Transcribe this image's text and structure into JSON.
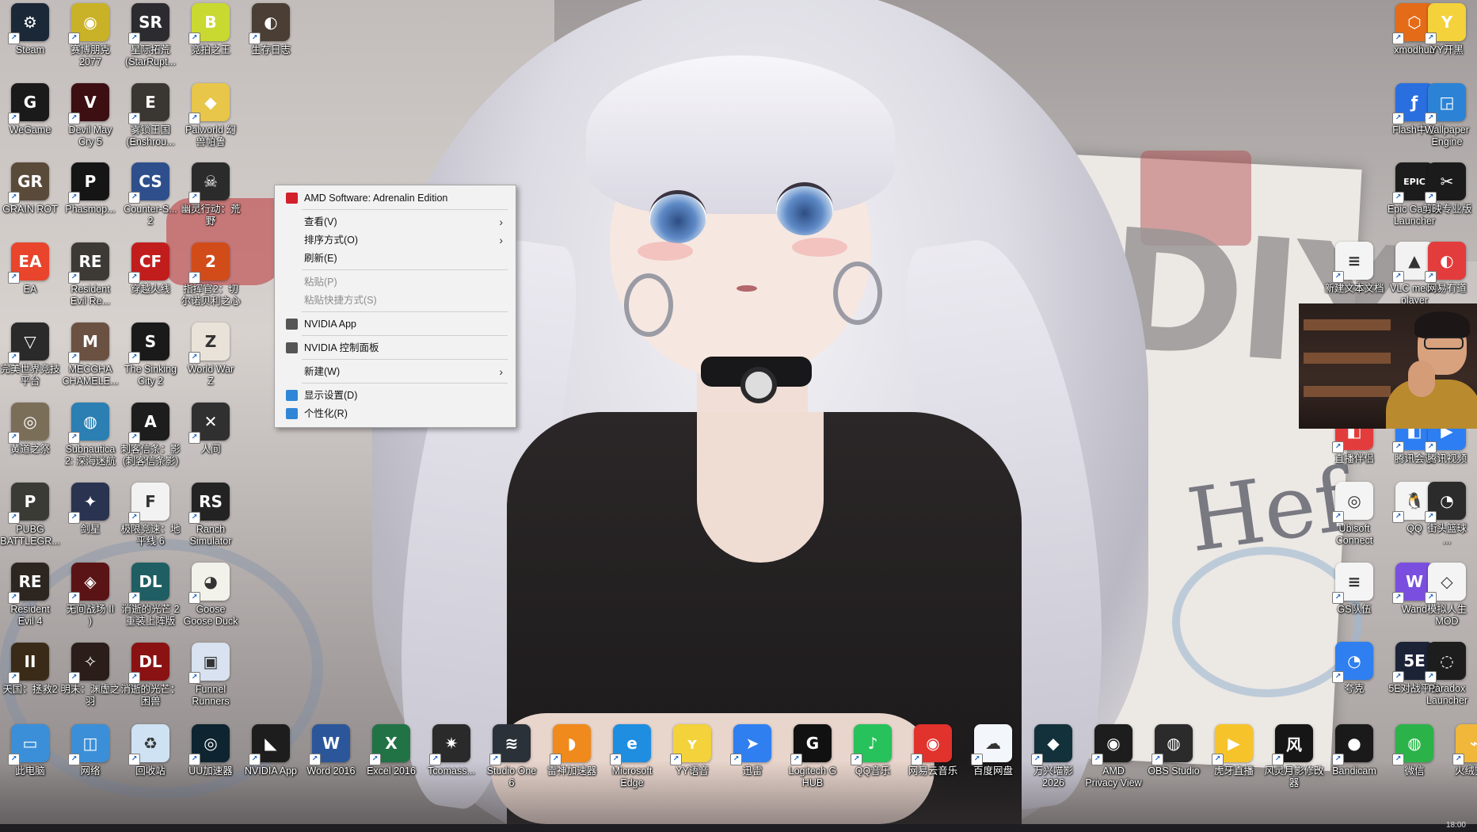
{
  "desktop_icons": [
    {
      "label": "Steam",
      "text": "",
      "bg": "#1b2838",
      "glyph": "⚙"
    },
    {
      "label": "赛博朋克\n2077",
      "text": "",
      "bg": "#c9b227",
      "glyph": "◉"
    },
    {
      "label": "星际拓荒\n(StarRupt...",
      "text": "",
      "bg": "#2c2b30",
      "glyph": "SR"
    },
    {
      "label": "竞拍之王",
      "text": "",
      "bg": "#c9d931",
      "glyph": "B"
    },
    {
      "label": "生存日志",
      "text": "",
      "bg": "#4a3e35",
      "glyph": "◐"
    },
    {
      "label": "WeGame",
      "text": "",
      "bg": "#1a1a1a",
      "glyph": "G"
    },
    {
      "label": "Devil May\nCry 5",
      "text": "",
      "bg": "#3d0f12",
      "glyph": "V"
    },
    {
      "label": "雾锁王国\n(Enshrou...",
      "text": "",
      "bg": "#3a3631",
      "glyph": "E"
    },
    {
      "label": "Palworld 幻\n兽帕鲁",
      "text": "",
      "bg": "#e7c64a",
      "glyph": "◆"
    },
    {
      "label": "GRAIN ROT",
      "text": "",
      "bg": "#5a4a3a",
      "glyph": "GR"
    },
    {
      "label": "Phasmop...",
      "text": "",
      "bg": "#151515",
      "glyph": "P"
    },
    {
      "label": "Counter-S...\n2",
      "text": "",
      "bg": "#2e4f8c",
      "glyph": "CS"
    },
    {
      "label": "幽灵行动：荒\n野",
      "text": "",
      "bg": "#2b2b2b",
      "glyph": "☠"
    },
    {
      "label": "EA",
      "text": "",
      "bg": "#e8452c",
      "glyph": "EA"
    },
    {
      "label": "Resident\nEvil Re...",
      "text": "",
      "bg": "#3d3a36",
      "glyph": "RE"
    },
    {
      "label": "穿越火线",
      "text": "",
      "bg": "#c21d1d",
      "glyph": "CF"
    },
    {
      "label": "指挥官2：切\n尔诺贝利之心",
      "text": "",
      "bg": "#d24c1a",
      "glyph": "2"
    },
    {
      "label": "完美世界竞技\n平台",
      "text": "",
      "bg": "#2a2a2a",
      "glyph": "▽"
    },
    {
      "label": "MECGHA\nCHAMELE...",
      "text": "",
      "bg": "#6a5142",
      "glyph": "M"
    },
    {
      "label": "The Sinking\nCity 2",
      "text": "",
      "bg": "#1a1a1a",
      "glyph": "S"
    },
    {
      "label": "World War\nZ",
      "text": "",
      "bg": "#e9e2d8",
      "glyph": "Z"
    },
    {
      "label": "黄道之祭",
      "text": "",
      "bg": "#7b6e59",
      "glyph": "◎"
    },
    {
      "label": "Subnautica\n2: 深海迷航",
      "text": "",
      "bg": "#2b7fb2",
      "glyph": "◍"
    },
    {
      "label": "刺客信条：影\n(刺客信条影)",
      "text": "",
      "bg": "#1d1d1d",
      "glyph": "A"
    },
    {
      "label": "人间",
      "text": "",
      "bg": "#303030",
      "glyph": "✕"
    },
    {
      "label": "PUBG\nBATTLEGR...",
      "text": "",
      "bg": "#3b3b35",
      "glyph": "P"
    },
    {
      "label": "剑星",
      "text": "",
      "bg": "#2a3350",
      "glyph": "✦"
    },
    {
      "label": "极限竞速：地\n平线 6",
      "text": "",
      "bg": "#f2f2f2",
      "glyph": "F"
    },
    {
      "label": "Ranch\nSimulator",
      "text": "",
      "bg": "#232323",
      "glyph": "RS"
    },
    {
      "label": "Resident\nEvil 4",
      "text": "",
      "bg": "#2c2520",
      "glyph": "RE"
    },
    {
      "label": "无间战场 II\n)",
      "text": "",
      "bg": "#5b1416",
      "glyph": "◈"
    },
    {
      "label": "消逝的光芒 2\n重装上阵版",
      "text": "",
      "bg": "#1f5f63",
      "glyph": "DL"
    },
    {
      "label": "Goose\nGoose Duck",
      "text": "",
      "bg": "#f2f2ea",
      "glyph": "◕"
    },
    {
      "label": "天国：拯救2",
      "text": "",
      "bg": "#3a2b18",
      "glyph": "II"
    },
    {
      "label": "明末：渊虚之\n羽",
      "text": "",
      "bg": "#2a1d1a",
      "glyph": "✧"
    },
    {
      "label": "消逝的光芒：\n困兽",
      "text": "",
      "bg": "#8a1212",
      "glyph": "DL"
    },
    {
      "label": "Funnel\nRunners",
      "text": "",
      "bg": "#d8e2f0",
      "glyph": "▣"
    }
  ],
  "bottom_row": [
    {
      "label": "此电脑",
      "bg": "#3b8fd8",
      "glyph": "▭"
    },
    {
      "label": "网络",
      "bg": "#3b8fd8",
      "glyph": "◫"
    },
    {
      "label": "回收站",
      "bg": "#cfe2f3",
      "glyph": "♻"
    },
    {
      "label": "UU加速器",
      "bg": "#0e2430",
      "glyph": "◎"
    },
    {
      "label": "NVIDIA App",
      "bg": "#1d1d1d",
      "glyph": "◣"
    },
    {
      "label": "Word 2016",
      "bg": "#2b579a",
      "glyph": "W"
    },
    {
      "label": "Excel 2016",
      "bg": "#217346",
      "glyph": "X"
    },
    {
      "label": "Tcomass...",
      "bg": "#2a2a2a",
      "glyph": "✷"
    },
    {
      "label": "Studio One\n6",
      "bg": "#2b3138",
      "glyph": "≋"
    },
    {
      "label": "雷神加速器",
      "bg": "#f08a1c",
      "glyph": "◗"
    },
    {
      "label": "Microsoft\nEdge",
      "bg": "#1f8ee0",
      "glyph": "e"
    },
    {
      "label": "YY语音",
      "bg": "#f3d23b",
      "glyph": "ʏ"
    },
    {
      "label": "迅雷",
      "bg": "#2f7ff0",
      "glyph": "➤"
    },
    {
      "label": "Logitech G\nHUB",
      "bg": "#111111",
      "glyph": "G"
    },
    {
      "label": "QQ音乐",
      "bg": "#27c25b",
      "glyph": "♪"
    },
    {
      "label": "网易云音乐",
      "bg": "#e1322c",
      "glyph": "◉"
    },
    {
      "label": "百度网盘",
      "bg": "#f3f6fb",
      "glyph": "☁"
    },
    {
      "label": "万兴喵影\n2026",
      "bg": "#13313a",
      "glyph": "◆"
    },
    {
      "label": "AMD\nPrivacy View",
      "bg": "#1d1d1d",
      "glyph": "◉"
    },
    {
      "label": "OBS Studio",
      "bg": "#2b2b2b",
      "glyph": "◍"
    },
    {
      "label": "虎牙直播",
      "bg": "#f6c42a",
      "glyph": "▶"
    },
    {
      "label": "风灵月影修改\n器",
      "bg": "#161616",
      "glyph": "风"
    },
    {
      "label": "Bandicam",
      "bg": "#1a1a1a",
      "glyph": "●"
    },
    {
      "label": "微信",
      "bg": "#2bb34a",
      "glyph": "◍"
    },
    {
      "label": "火绒安全",
      "bg": "#f1b73a",
      "glyph": "⌁"
    }
  ],
  "right_icons": [
    {
      "label": "xmodhub",
      "bg": "#e46b18",
      "glyph": "⬡"
    },
    {
      "label": "YY开黑",
      "bg": "#f3d23b",
      "glyph": "Y"
    },
    {
      "label": "Flash中心",
      "bg": "#2a6fe0",
      "glyph": "ƒ"
    },
    {
      "label": "Wallpaper\nEngine",
      "bg": "#2c83d6",
      "glyph": "◲"
    },
    {
      "label": "Epic Games\nLauncher",
      "bg": "#1c1c1c",
      "glyph": "EPIC"
    },
    {
      "label": "剪映专业版",
      "bg": "#1b1b1b",
      "glyph": "✂"
    },
    {
      "label": "新建文本文档",
      "bg": "#f4f4f4",
      "glyph": "≡"
    },
    {
      "label": "VLC media\nplayer",
      "bg": "#f2f2f2",
      "glyph": "▲"
    },
    {
      "label": "网易有道",
      "bg": "#e33c3c",
      "glyph": "◐"
    },
    {
      "label": "直播伴侣",
      "bg": "#e33c3c",
      "glyph": "◧"
    },
    {
      "label": "腾讯会议",
      "bg": "#2d7ef2",
      "glyph": "◧"
    },
    {
      "label": "腾讯视频",
      "bg": "#2d7ef2",
      "glyph": "▶"
    },
    {
      "label": "Ubisoft\nConnect",
      "bg": "#f4f4f4",
      "glyph": "◎"
    },
    {
      "label": "QQ",
      "bg": "#f4f4f4",
      "glyph": "🐧"
    },
    {
      "label": "街头篮球\n...",
      "bg": "#2b2b2b",
      "glyph": "◔"
    },
    {
      "label": "GS队伍",
      "bg": "#f4f4f4",
      "glyph": "≡"
    },
    {
      "label": "Wand",
      "bg": "#7a4fe0",
      "glyph": "W"
    },
    {
      "label": "模拟人生\nMOD",
      "bg": "#f4f4f4",
      "glyph": "◇"
    },
    {
      "label": "夸克",
      "bg": "#2f7ff0",
      "glyph": "◔"
    },
    {
      "label": "5E对战平台",
      "bg": "#1c2337",
      "glyph": "5E"
    },
    {
      "label": "Paradox\nLauncher",
      "bg": "#1d1d1d",
      "glyph": "◌"
    }
  ],
  "context_menu": {
    "items": [
      {
        "label": "AMD Software: Adrenalin Edition",
        "icon": "amd-icon",
        "icon_color": "#d2202c"
      },
      {
        "label": "查看(V)",
        "submenu": true
      },
      {
        "label": "排序方式(O)",
        "submenu": true
      },
      {
        "label": "刷新(E)"
      },
      {
        "label": "粘贴(P)",
        "disabled": true
      },
      {
        "label": "粘贴快捷方式(S)",
        "disabled": true
      },
      {
        "label": "NVIDIA App",
        "icon": "nvidia-icon",
        "icon_color": "#555555"
      },
      {
        "label": "NVIDIA 控制面板",
        "icon": "nvidia-control-icon",
        "icon_color": "#555555"
      },
      {
        "label": "新建(W)",
        "submenu": true
      },
      {
        "label": "显示设置(D)",
        "icon": "display-icon",
        "icon_color": "#2f86d6"
      },
      {
        "label": "个性化(R)",
        "icon": "personalize-icon",
        "icon_color": "#2f86d6"
      }
    ],
    "submenu_arrow": "›"
  },
  "clock": "18:00",
  "taskbar_color": "#1e1e22"
}
